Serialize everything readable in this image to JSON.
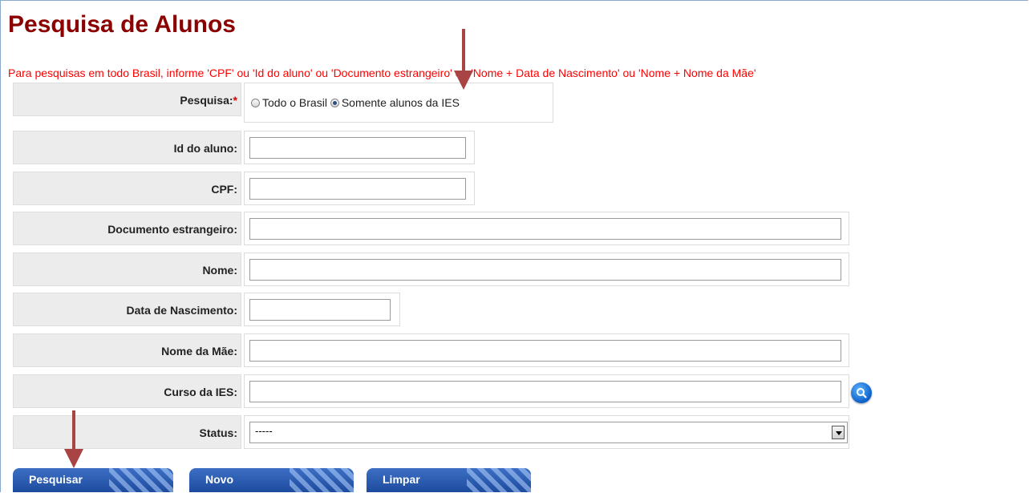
{
  "page": {
    "title": "Pesquisa de Alunos",
    "info": "Para pesquisas em todo Brasil, informe 'CPF' ou 'Id do aluno' ou 'Documento estrangeiro' ou 'Nome + Data de Nascimento' ou 'Nome + Nome da Mãe'"
  },
  "form": {
    "pesquisa_label": "Pesquisa:",
    "required_mark": "*",
    "radio_todo": "Todo o Brasil",
    "radio_somente": "Somente alunos da IES",
    "radio_selected": "Somente alunos da IES",
    "id_label": "Id do aluno:",
    "id_value": "",
    "cpf_label": "CPF:",
    "cpf_value": "",
    "doc_label": "Documento estrangeiro:",
    "doc_value": "",
    "nome_label": "Nome:",
    "nome_value": "",
    "nasc_label": "Data de Nascimento:",
    "nasc_value": "",
    "mae_label": "Nome da Mãe:",
    "mae_value": "",
    "curso_label": "Curso da IES:",
    "curso_value": "",
    "status_label": "Status:",
    "status_value": "-----"
  },
  "buttons": {
    "pesquisar": "Pesquisar",
    "novo": "Novo",
    "limpar": "Limpar"
  },
  "icons": {
    "lookup": "search-icon",
    "annotation": "red-arrow"
  },
  "colors": {
    "title": "#8b0000",
    "info": "#ff0000",
    "button": "#1d4b9e",
    "arrow": "#a94444"
  }
}
